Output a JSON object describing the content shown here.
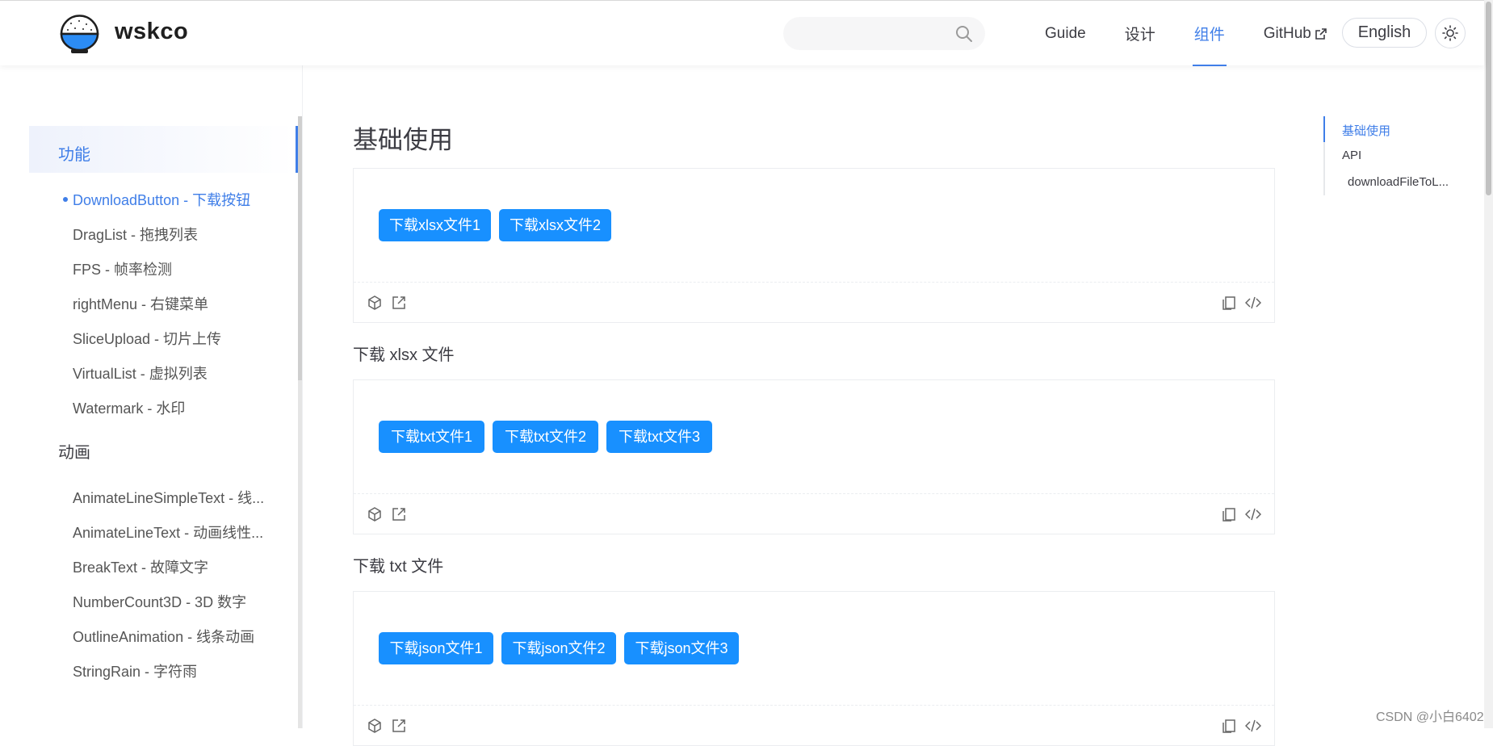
{
  "header": {
    "site_title": "wskco",
    "nav": [
      {
        "label": "Guide"
      },
      {
        "label": "设计"
      },
      {
        "label": "组件"
      },
      {
        "label": "GitHub"
      }
    ],
    "lang_label": "English"
  },
  "sidebar": {
    "groups": [
      {
        "title": "功能",
        "items": [
          {
            "label": "DownloadButton - 下载按钮"
          },
          {
            "label": "DragList - 拖拽列表"
          },
          {
            "label": "FPS - 帧率检测"
          },
          {
            "label": "rightMenu - 右键菜单"
          },
          {
            "label": "SliceUpload - 切片上传"
          },
          {
            "label": "VirtualList - 虚拟列表"
          },
          {
            "label": "Watermark - 水印"
          }
        ]
      },
      {
        "title": "动画",
        "items": [
          {
            "label": "AnimateLineSimpleText - 线..."
          },
          {
            "label": "AnimateLineText - 动画线性..."
          },
          {
            "label": "BreakText - 故障文字"
          },
          {
            "label": "NumberCount3D - 3D 数字"
          },
          {
            "label": "OutlineAnimation - 线条动画"
          },
          {
            "label": "StringRain - 字符雨"
          }
        ]
      }
    ]
  },
  "main": {
    "title": "基础使用",
    "demos": [
      {
        "buttons": [
          "下载xlsx文件1",
          "下载xlsx文件2"
        ],
        "caption": "下载 xlsx 文件"
      },
      {
        "buttons": [
          "下载txt文件1",
          "下载txt文件2",
          "下载txt文件3"
        ],
        "caption": "下载 txt 文件"
      },
      {
        "buttons": [
          "下载json文件1",
          "下载json文件2",
          "下载json文件3"
        ]
      }
    ]
  },
  "toc": {
    "items": [
      {
        "label": "基础使用"
      },
      {
        "label": "API"
      },
      {
        "label": "downloadFileToL..."
      }
    ]
  },
  "watermark": "CSDN @小白6402",
  "colors": {
    "accent": "#3f7ee8",
    "button": "#1890ff"
  }
}
